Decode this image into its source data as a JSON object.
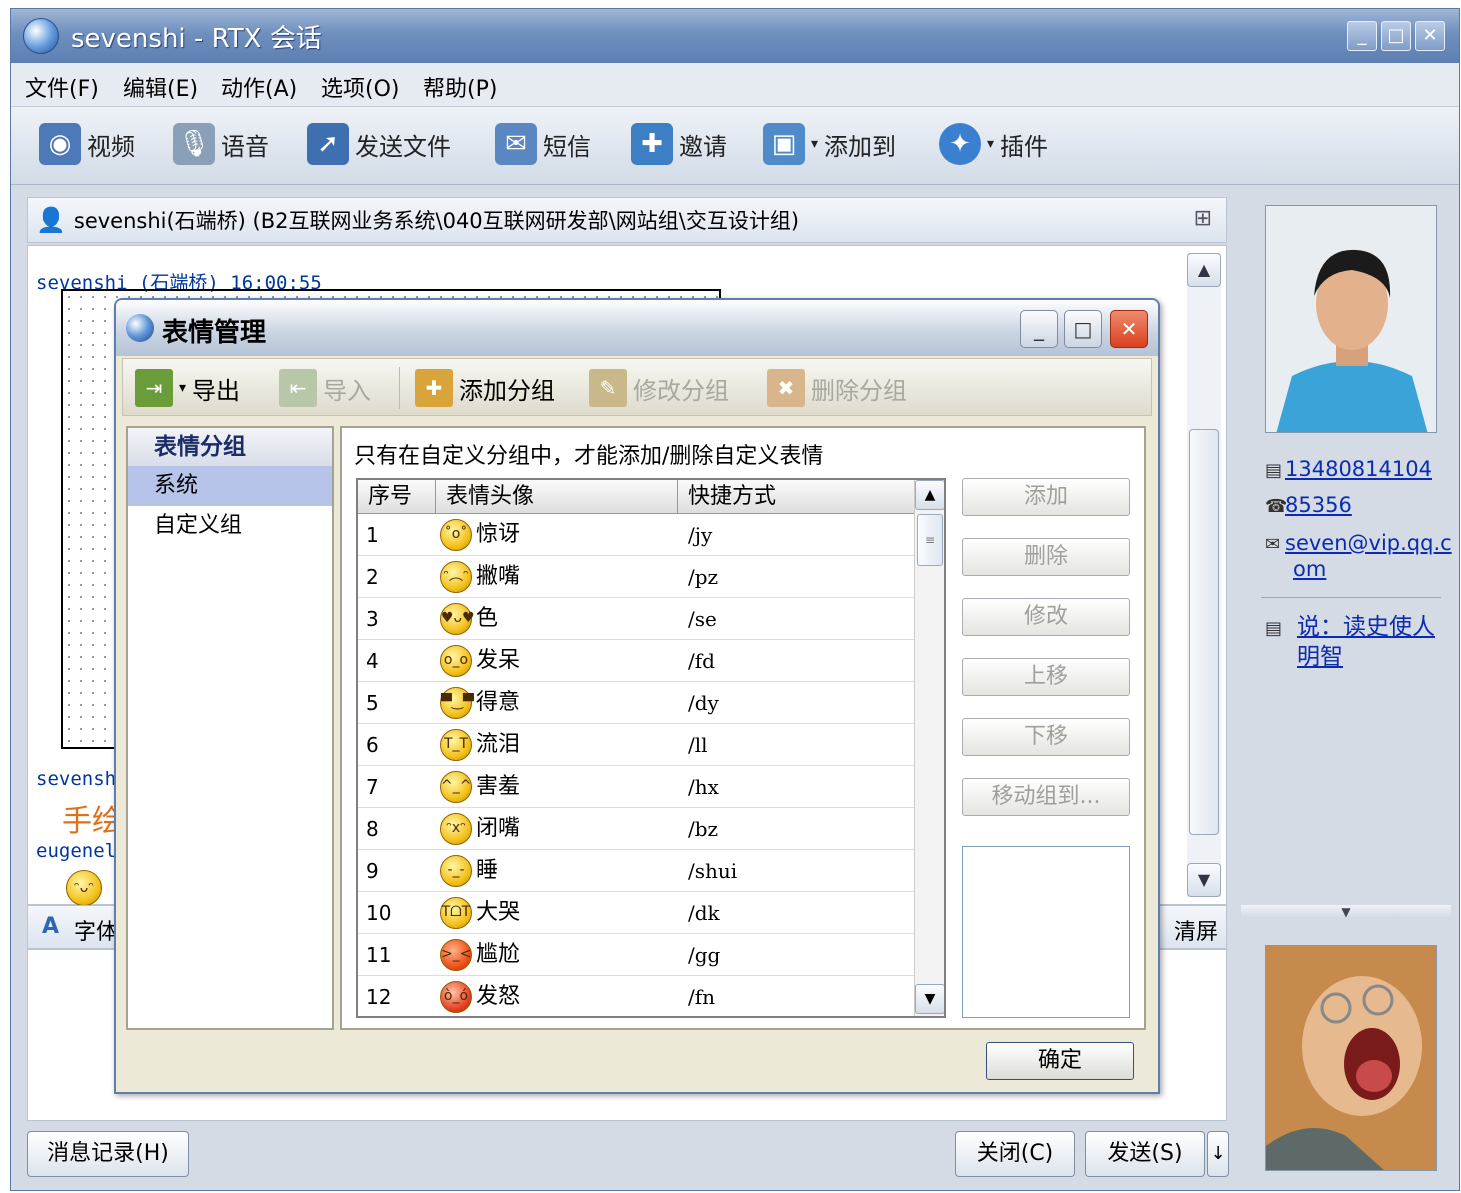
{
  "window": {
    "title": "sevenshi - RTX 会话",
    "controls": [
      "minimize",
      "maximize",
      "close"
    ]
  },
  "menu": [
    "文件(F)",
    "编辑(E)",
    "动作(A)",
    "选项(O)",
    "帮助(P)"
  ],
  "toolbar": [
    {
      "label": "视频",
      "icon": "video-camera-icon"
    },
    {
      "label": "语音",
      "icon": "microphone-icon"
    },
    {
      "label": "发送文件",
      "icon": "send-file-icon"
    },
    {
      "label": "短信",
      "icon": "sms-icon"
    },
    {
      "label": "邀请",
      "icon": "invite-icon"
    },
    {
      "label": "添加到",
      "icon": "add-to-icon"
    },
    {
      "label": "插件",
      "icon": "plugin-icon"
    }
  ],
  "chat": {
    "header": "sevenshi(石端桥) (B2互联网业务系统\\040互联网研发部\\网站组\\交互设计组)",
    "messages": [
      {
        "sender": "sevenshi (石端桥) 16:00:55"
      },
      {
        "sender": "sevensh",
        "text": "手绘"
      },
      {
        "sender": "eugenel"
      }
    ],
    "font_label": "字体",
    "clear_label": "清屏"
  },
  "bottom": {
    "history": "消息记录(H)",
    "close": "关闭(C)",
    "send": "发送(S)",
    "send_arrow": "↓"
  },
  "contact": {
    "phone": "13480814104",
    "ext": "85356",
    "email_line1": "seven@vip.qq.c",
    "email_line2": "om",
    "status_line1": "说：读史使人",
    "status_line2": "明智"
  },
  "dialog": {
    "title": "表情管理",
    "toolbar": [
      {
        "label": "导出",
        "enabled": true,
        "dropdown": true
      },
      {
        "label": "导入",
        "enabled": false
      },
      {
        "label": "添加分组",
        "enabled": true
      },
      {
        "label": "修改分组",
        "enabled": false
      },
      {
        "label": "删除分组",
        "enabled": false
      }
    ],
    "groups_header": "表情分组",
    "groups": [
      "系统",
      "自定义组"
    ],
    "selected_group": "系统",
    "info": "只有在自定义分组中，才能添加/删除自定义表情",
    "columns": [
      "序号",
      "表情头像",
      "快捷方式"
    ],
    "rows": [
      {
        "idx": "1",
        "name": "惊讶",
        "key": "/jy"
      },
      {
        "idx": "2",
        "name": "撇嘴",
        "key": "/pz"
      },
      {
        "idx": "3",
        "name": "色",
        "key": "/se"
      },
      {
        "idx": "4",
        "name": "发呆",
        "key": "/fd"
      },
      {
        "idx": "5",
        "name": "得意",
        "key": "/dy"
      },
      {
        "idx": "6",
        "name": "流泪",
        "key": "/ll"
      },
      {
        "idx": "7",
        "name": "害羞",
        "key": "/hx"
      },
      {
        "idx": "8",
        "name": "闭嘴",
        "key": "/bz"
      },
      {
        "idx": "9",
        "name": "睡",
        "key": "/shui"
      },
      {
        "idx": "10",
        "name": "大哭",
        "key": "/dk"
      },
      {
        "idx": "11",
        "name": "尴尬",
        "key": "/gg"
      },
      {
        "idx": "12",
        "name": "发怒",
        "key": "/fn"
      }
    ],
    "side_buttons": [
      "添加",
      "删除",
      "修改",
      "上移",
      "下移",
      "移动组到..."
    ],
    "ok": "确定"
  }
}
